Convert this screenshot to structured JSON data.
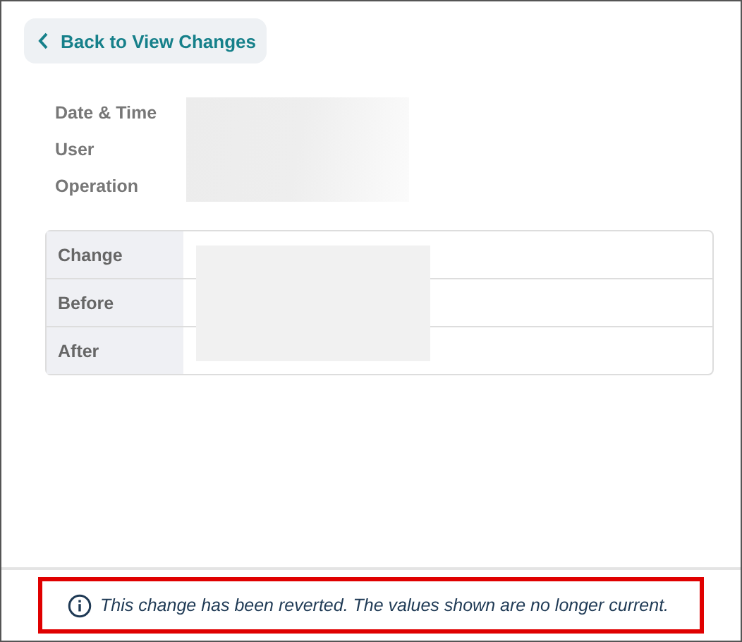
{
  "back_button": {
    "label": "Back to View Changes"
  },
  "summary": [
    {
      "label": "Date & Time"
    },
    {
      "label": "User"
    },
    {
      "label": "Operation"
    }
  ],
  "details": [
    {
      "label": "Change"
    },
    {
      "label": "Before"
    },
    {
      "label": "After"
    }
  ],
  "notice": {
    "text": "This change has been reverted. The values shown are no longer current.",
    "highlighted": true
  }
}
